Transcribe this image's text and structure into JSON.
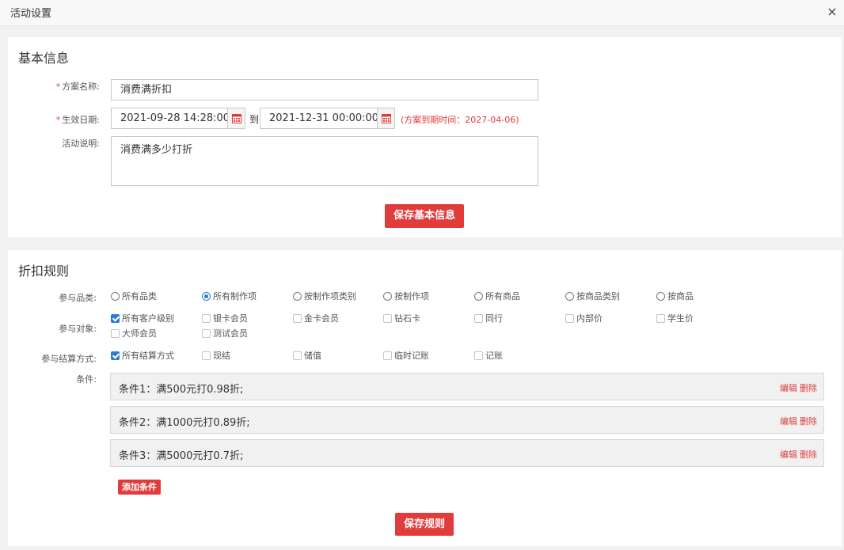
{
  "window": {
    "title": "活动设置",
    "close_glyph": "×"
  },
  "basic": {
    "title": "基本信息",
    "required_mark": "*",
    "name_label": "方案名称:",
    "name_value": "消费满折扣",
    "date_label": "生效日期:",
    "start_date": "2021-09-28 14:28:00",
    "date_to": "到",
    "end_date": "2021-12-31 00:00:00",
    "expire_note": "(方案到期时间：2027-04-06)",
    "desc_label": "活动说明:",
    "desc_value": "消费满多少打折",
    "save_label": "保存基本信息"
  },
  "rule": {
    "title": "折扣规则",
    "category_label": "参与品类:",
    "category_options": [
      {
        "label": "所有品类",
        "checked": false
      },
      {
        "label": "所有制作项",
        "checked": true
      },
      {
        "label": "按制作项类别",
        "checked": false
      },
      {
        "label": "按制作项",
        "checked": false
      },
      {
        "label": "所有商品",
        "checked": false
      },
      {
        "label": "按商品类别",
        "checked": false
      },
      {
        "label": "按商品",
        "checked": false
      }
    ],
    "target_label": "参与对象:",
    "target_options": [
      {
        "label": "所有客户级别",
        "checked": true
      },
      {
        "label": "银卡会员",
        "checked": false
      },
      {
        "label": "金卡会员",
        "checked": false
      },
      {
        "label": "钻石卡",
        "checked": false
      },
      {
        "label": "同行",
        "checked": false
      },
      {
        "label": "内部价",
        "checked": false
      },
      {
        "label": "学生价",
        "checked": false
      },
      {
        "label": "大师会员",
        "checked": false
      },
      {
        "label": "测试会员",
        "checked": false
      }
    ],
    "payment_label": "参与结算方式:",
    "payment_options": [
      {
        "label": "所有结算方式",
        "checked": true
      },
      {
        "label": "现结",
        "checked": false
      },
      {
        "label": "储值",
        "checked": false
      },
      {
        "label": "临时记账",
        "checked": false
      },
      {
        "label": "记账",
        "checked": false
      }
    ],
    "conditions_label": "条件:",
    "conditions": [
      {
        "text": "条件1：满500元打0.98折;"
      },
      {
        "text": "条件2：满1000元打0.89折;"
      },
      {
        "text": "条件3：满5000元打0.7折;"
      }
    ],
    "edit_label": "编辑",
    "delete_label": "删除",
    "add_label": "添加条件",
    "save_label": "保存规则"
  },
  "colors": {
    "accent": "#e03c3c",
    "checked": "#2a7bd8",
    "background": "#f1f1f1"
  },
  "icons": {
    "close": "close-icon",
    "calendar": "calendar-icon"
  }
}
